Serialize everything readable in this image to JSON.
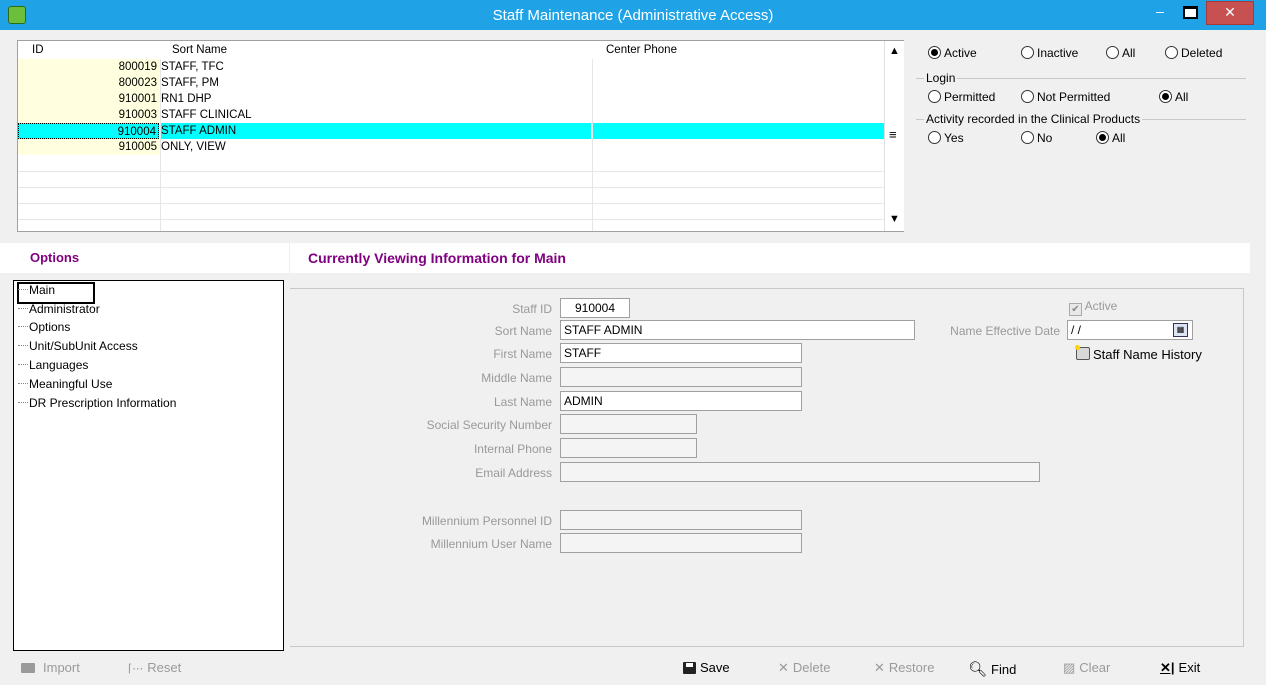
{
  "window": {
    "title": "Staff Maintenance (Administrative Access)"
  },
  "grid": {
    "headers": {
      "id": "ID",
      "sort_name": "Sort Name",
      "center_phone": "Center Phone"
    },
    "rows": [
      {
        "id": "800019",
        "name": "STAFF, TFC",
        "selected": false
      },
      {
        "id": "800023",
        "name": "STAFF, PM",
        "selected": false
      },
      {
        "id": "910001",
        "name": "RN1 DHP",
        "selected": false
      },
      {
        "id": "910003",
        "name": "STAFF CLINICAL",
        "selected": false
      },
      {
        "id": "910004",
        "name": "STAFF ADMIN",
        "selected": true
      },
      {
        "id": "910005",
        "name": "ONLY, VIEW",
        "selected": false
      }
    ]
  },
  "filters": {
    "status": {
      "options": [
        "Active",
        "Inactive",
        "All",
        "Deleted"
      ],
      "selected": "Active"
    },
    "login": {
      "label": "Login",
      "options": [
        "Permitted",
        "Not Permitted",
        "All"
      ],
      "selected": "All"
    },
    "activity": {
      "label": "Activity recorded in the Clinical Products",
      "options": [
        "Yes",
        "No",
        "All"
      ],
      "selected": "All"
    }
  },
  "options_panel": {
    "title": "Options",
    "items": [
      "Main",
      "Administrator",
      "Options",
      "Unit/SubUnit Access",
      "Languages",
      "Meaningful Use",
      "DR Prescription Information"
    ],
    "selected": "Main"
  },
  "main": {
    "title": "Currently Viewing Information for Main",
    "fields": {
      "staff_id": {
        "label": "Staff ID",
        "value": "910004"
      },
      "sort_name": {
        "label": "Sort Name",
        "value": "STAFF ADMIN"
      },
      "first_name": {
        "label": "First Name",
        "value": "STAFF"
      },
      "middle_name": {
        "label": "Middle Name",
        "value": ""
      },
      "last_name": {
        "label": "Last Name",
        "value": "ADMIN"
      },
      "ssn": {
        "label": "Social Security Number",
        "value": ""
      },
      "internal_phone": {
        "label": "Internal Phone",
        "value": ""
      },
      "email": {
        "label": "Email Address",
        "value": ""
      },
      "millennium_id": {
        "label": "Millennium Personnel ID",
        "value": ""
      },
      "millennium_user": {
        "label": "Millennium User Name",
        "value": ""
      }
    },
    "active_label": "Active",
    "active_checked": true,
    "name_effective_date": {
      "label": "Name Effective Date",
      "value": " / /"
    },
    "history_link": "Staff Name History"
  },
  "toolbar": {
    "import": "Import",
    "reset": "Reset",
    "save": "Save",
    "delete": "Delete",
    "restore": "Restore",
    "find": "Find",
    "clear": "Clear",
    "exit": "Exit"
  }
}
